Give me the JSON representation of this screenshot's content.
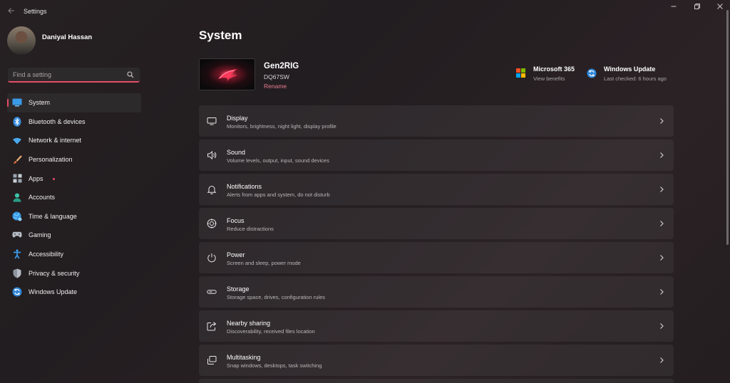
{
  "window": {
    "title": "Settings"
  },
  "user": {
    "name": "Daniyal Hassan"
  },
  "search": {
    "placeholder": "Find a setting"
  },
  "sidebar": {
    "items": [
      {
        "label": "System",
        "icon": "system-icon"
      },
      {
        "label": "Bluetooth & devices",
        "icon": "bluetooth-icon"
      },
      {
        "label": "Network & internet",
        "icon": "wifi-icon"
      },
      {
        "label": "Personalization",
        "icon": "brush-icon"
      },
      {
        "label": "Apps",
        "icon": "apps-icon"
      },
      {
        "label": "Accounts",
        "icon": "accounts-icon"
      },
      {
        "label": "Time & language",
        "icon": "globe-icon"
      },
      {
        "label": "Gaming",
        "icon": "gamepad-icon"
      },
      {
        "label": "Accessibility",
        "icon": "accessibility-icon"
      },
      {
        "label": "Privacy & security",
        "icon": "shield-icon"
      },
      {
        "label": "Windows Update",
        "icon": "update-icon"
      }
    ]
  },
  "main": {
    "title": "System",
    "device": {
      "name": "Gen2RIG",
      "model": "DQ67SW",
      "rename_label": "Rename"
    },
    "quick_links": [
      {
        "title": "Microsoft 365",
        "subtitle": "View benefits",
        "icon": "microsoft-logo-icon"
      },
      {
        "title": "Windows Update",
        "subtitle": "Last checked: 6 hours ago",
        "icon": "update-icon"
      }
    ],
    "settings": [
      {
        "title": "Display",
        "subtitle": "Monitors, brightness, night light, display profile",
        "icon": "display-icon"
      },
      {
        "title": "Sound",
        "subtitle": "Volume levels, output, input, sound devices",
        "icon": "speaker-icon"
      },
      {
        "title": "Notifications",
        "subtitle": "Alerts from apps and system, do not disturb",
        "icon": "bell-icon"
      },
      {
        "title": "Focus",
        "subtitle": "Reduce distractions",
        "icon": "focus-icon"
      },
      {
        "title": "Power",
        "subtitle": "Screen and sleep, power mode",
        "icon": "power-icon"
      },
      {
        "title": "Storage",
        "subtitle": "Storage space, drives, configuration rules",
        "icon": "storage-icon"
      },
      {
        "title": "Nearby sharing",
        "subtitle": "Discoverability, received files location",
        "icon": "share-icon"
      },
      {
        "title": "Multitasking",
        "subtitle": "Snap windows, desktops, task switching",
        "icon": "multitasking-icon"
      }
    ]
  },
  "colors": {
    "accent": "#e44c68",
    "background": "#242022",
    "card": "#302b2d"
  }
}
